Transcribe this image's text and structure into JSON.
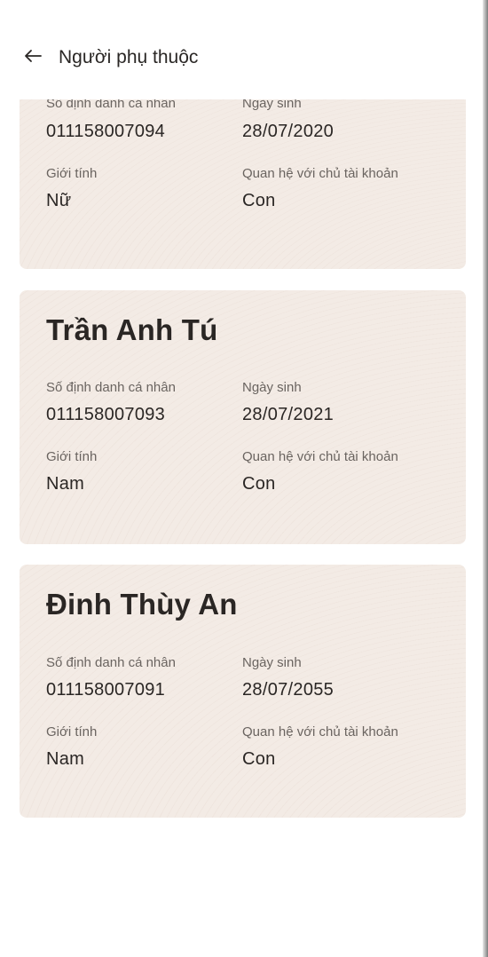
{
  "header": {
    "title": "Người phụ thuộc",
    "back_icon": "arrow-left-icon"
  },
  "labels": {
    "id_number": "Số định danh cá nhân",
    "birth_date": "Ngày sinh",
    "gender": "Giới tính",
    "relation": "Quan hệ với chủ tài khoản"
  },
  "dependents": [
    {
      "name": "",
      "id_number": "011158007094",
      "birth_date": "28/07/2020",
      "gender": "Nữ",
      "relation": "Con"
    },
    {
      "name": "Trần Anh Tú",
      "id_number": "011158007093",
      "birth_date": "28/07/2021",
      "gender": "Nam",
      "relation": "Con"
    },
    {
      "name": "Đinh Thùy An",
      "id_number": "011158007091",
      "birth_date": "28/07/2055",
      "gender": "Nam",
      "relation": "Con"
    }
  ],
  "colors": {
    "card_bg": "#f3ebe5",
    "text_primary": "#2a2624",
    "text_secondary": "#6a6460"
  }
}
